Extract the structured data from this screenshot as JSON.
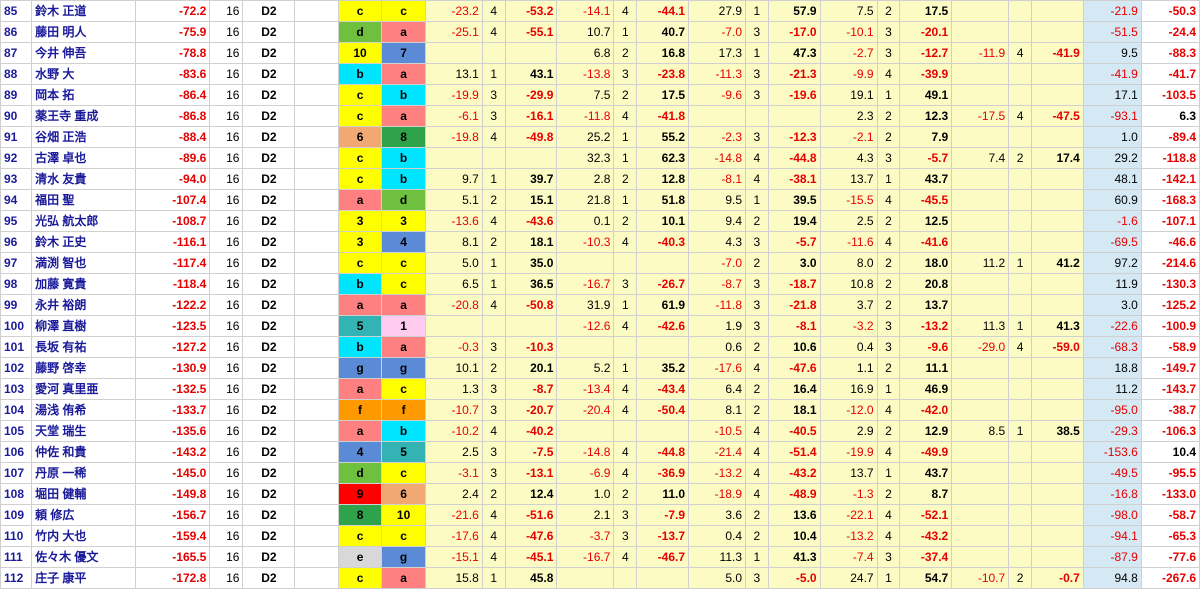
{
  "colors": {
    "a": "#ff8080",
    "b": "#00e5ff",
    "c": "#ffff00",
    "d": "#70c040",
    "e": "#d8d8d8",
    "f": "#ff9900",
    "g": "#5b8ad6",
    "1": "#ffccf0",
    "3": "#ffff00",
    "4": "#5b8ad6",
    "5": "#33b3b3",
    "6": "#f2a873",
    "7": "#5b8ad6",
    "8": "#2ea34c",
    "9": "#ff0000",
    "10": "#ffff00"
  },
  "rows": [
    {
      "no": "85",
      "name": "鈴木 正道",
      "total": "-72.2",
      "games": "16",
      "div": "D2",
      "g1": "c",
      "g2": "c",
      "cols": [
        "-23.2",
        "4",
        "-53.2",
        "-14.1",
        "4",
        "-44.1",
        "27.9",
        "1",
        "57.9",
        "7.5",
        "2",
        "17.5",
        "",
        "",
        "",
        "-21.9",
        "-50.3"
      ]
    },
    {
      "no": "86",
      "name": "藤田 明人",
      "total": "-75.9",
      "games": "16",
      "div": "D2",
      "g1": "d",
      "g2": "a",
      "cols": [
        "-25.1",
        "4",
        "-55.1",
        "10.7",
        "1",
        "40.7",
        "-7.0",
        "3",
        "-17.0",
        "-10.1",
        "3",
        "-20.1",
        "",
        "",
        "",
        "-51.5",
        "-24.4"
      ]
    },
    {
      "no": "87",
      "name": "今井 伸吾",
      "total": "-78.8",
      "games": "16",
      "div": "D2",
      "g1": "10",
      "g2": "7",
      "cols": [
        "",
        "",
        "",
        "6.8",
        "2",
        "16.8",
        "17.3",
        "1",
        "47.3",
        "-2.7",
        "3",
        "-12.7",
        "-11.9",
        "4",
        "-41.9",
        "9.5",
        "-88.3"
      ]
    },
    {
      "no": "88",
      "name": "水野 大",
      "total": "-83.6",
      "games": "16",
      "div": "D2",
      "g1": "b",
      "g2": "a",
      "cols": [
        "13.1",
        "1",
        "43.1",
        "-13.8",
        "3",
        "-23.8",
        "-11.3",
        "3",
        "-21.3",
        "-9.9",
        "4",
        "-39.9",
        "",
        "",
        "",
        "-41.9",
        "-41.7"
      ]
    },
    {
      "no": "89",
      "name": "岡本 拓",
      "total": "-86.4",
      "games": "16",
      "div": "D2",
      "g1": "c",
      "g2": "b",
      "cols": [
        "-19.9",
        "3",
        "-29.9",
        "7.5",
        "2",
        "17.5",
        "-9.6",
        "3",
        "-19.6",
        "19.1",
        "1",
        "49.1",
        "",
        "",
        "",
        "17.1",
        "-103.5"
      ]
    },
    {
      "no": "90",
      "name": "薬王寺 重成",
      "total": "-86.8",
      "games": "16",
      "div": "D2",
      "g1": "c",
      "g2": "a",
      "cols": [
        "-6.1",
        "3",
        "-16.1",
        "-11.8",
        "4",
        "-41.8",
        "",
        "",
        "",
        "2.3",
        "2",
        "12.3",
        "-17.5",
        "4",
        "-47.5",
        "-93.1",
        "6.3"
      ]
    },
    {
      "no": "91",
      "name": "谷畑 正浩",
      "total": "-88.4",
      "games": "16",
      "div": "D2",
      "g1": "6",
      "g2": "8",
      "cols": [
        "-19.8",
        "4",
        "-49.8",
        "25.2",
        "1",
        "55.2",
        "-2.3",
        "3",
        "-12.3",
        "-2.1",
        "2",
        "7.9",
        "",
        "",
        "",
        "1.0",
        "-89.4"
      ]
    },
    {
      "no": "92",
      "name": "古澤 卓也",
      "total": "-89.6",
      "games": "16",
      "div": "D2",
      "g1": "c",
      "g2": "b",
      "cols": [
        "",
        "",
        "",
        "32.3",
        "1",
        "62.3",
        "-14.8",
        "4",
        "-44.8",
        "4.3",
        "3",
        "-5.7",
        "7.4",
        "2",
        "17.4",
        "29.2",
        "-118.8"
      ]
    },
    {
      "no": "93",
      "name": "清水 友貴",
      "total": "-94.0",
      "games": "16",
      "div": "D2",
      "g1": "c",
      "g2": "b",
      "cols": [
        "9.7",
        "1",
        "39.7",
        "2.8",
        "2",
        "12.8",
        "-8.1",
        "4",
        "-38.1",
        "13.7",
        "1",
        "43.7",
        "",
        "",
        "",
        "48.1",
        "-142.1"
      ]
    },
    {
      "no": "94",
      "name": "福田 聖",
      "total": "-107.4",
      "games": "16",
      "div": "D2",
      "g1": "a",
      "g2": "d",
      "cols": [
        "5.1",
        "2",
        "15.1",
        "21.8",
        "1",
        "51.8",
        "9.5",
        "1",
        "39.5",
        "-15.5",
        "4",
        "-45.5",
        "",
        "",
        "",
        "60.9",
        "-168.3"
      ]
    },
    {
      "no": "95",
      "name": "光弘 航太郎",
      "total": "-108.7",
      "games": "16",
      "div": "D2",
      "g1": "3",
      "g2": "3",
      "cols": [
        "-13.6",
        "4",
        "-43.6",
        "0.1",
        "2",
        "10.1",
        "9.4",
        "2",
        "19.4",
        "2.5",
        "2",
        "12.5",
        "",
        "",
        "",
        "-1.6",
        "-107.1"
      ]
    },
    {
      "no": "96",
      "name": "鈴木 正史",
      "total": "-116.1",
      "games": "16",
      "div": "D2",
      "g1": "3",
      "g2": "4",
      "cols": [
        "8.1",
        "2",
        "18.1",
        "-10.3",
        "4",
        "-40.3",
        "4.3",
        "3",
        "-5.7",
        "-11.6",
        "4",
        "-41.6",
        "",
        "",
        "",
        "-69.5",
        "-46.6"
      ]
    },
    {
      "no": "97",
      "name": "満渕 智也",
      "total": "-117.4",
      "games": "16",
      "div": "D2",
      "g1": "c",
      "g2": "c",
      "cols": [
        "5.0",
        "1",
        "35.0",
        "",
        "",
        "",
        "-7.0",
        "2",
        "3.0",
        "8.0",
        "2",
        "18.0",
        "11.2",
        "1",
        "41.2",
        "97.2",
        "-214.6"
      ]
    },
    {
      "no": "98",
      "name": "加藤 寛貴",
      "total": "-118.4",
      "games": "16",
      "div": "D2",
      "g1": "b",
      "g2": "c",
      "cols": [
        "6.5",
        "1",
        "36.5",
        "-16.7",
        "3",
        "-26.7",
        "-8.7",
        "3",
        "-18.7",
        "10.8",
        "2",
        "20.8",
        "",
        "",
        "",
        "11.9",
        "-130.3"
      ]
    },
    {
      "no": "99",
      "name": "永井 裕朗",
      "total": "-122.2",
      "games": "16",
      "div": "D2",
      "g1": "a",
      "g2": "a",
      "cols": [
        "-20.8",
        "4",
        "-50.8",
        "31.9",
        "1",
        "61.9",
        "-11.8",
        "3",
        "-21.8",
        "3.7",
        "2",
        "13.7",
        "",
        "",
        "",
        "3.0",
        "-125.2"
      ]
    },
    {
      "no": "100",
      "name": "柳澤 直樹",
      "total": "-123.5",
      "games": "16",
      "div": "D2",
      "g1": "5",
      "g2": "1",
      "cols": [
        "",
        "",
        "",
        "-12.6",
        "4",
        "-42.6",
        "1.9",
        "3",
        "-8.1",
        "-3.2",
        "3",
        "-13.2",
        "11.3",
        "1",
        "41.3",
        "-22.6",
        "-100.9"
      ]
    },
    {
      "no": "101",
      "name": "長坂 有祐",
      "total": "-127.2",
      "games": "16",
      "div": "D2",
      "g1": "b",
      "g2": "a",
      "cols": [
        "-0.3",
        "3",
        "-10.3",
        "",
        "",
        "",
        "0.6",
        "2",
        "10.6",
        "0.4",
        "3",
        "-9.6",
        "-29.0",
        "4",
        "-59.0",
        "-68.3",
        "-58.9"
      ]
    },
    {
      "no": "102",
      "name": "藤野 啓幸",
      "total": "-130.9",
      "games": "16",
      "div": "D2",
      "g1": "g",
      "g2": "g",
      "cols": [
        "10.1",
        "2",
        "20.1",
        "5.2",
        "1",
        "35.2",
        "-17.6",
        "4",
        "-47.6",
        "1.1",
        "2",
        "11.1",
        "",
        "",
        "",
        "18.8",
        "-149.7"
      ]
    },
    {
      "no": "103",
      "name": "愛河 真里亜",
      "total": "-132.5",
      "games": "16",
      "div": "D2",
      "g1": "a",
      "g2": "c",
      "cols": [
        "1.3",
        "3",
        "-8.7",
        "-13.4",
        "4",
        "-43.4",
        "6.4",
        "2",
        "16.4",
        "16.9",
        "1",
        "46.9",
        "",
        "",
        "",
        "11.2",
        "-143.7"
      ]
    },
    {
      "no": "104",
      "name": "湯浅 侑希",
      "total": "-133.7",
      "games": "16",
      "div": "D2",
      "g1": "f",
      "g2": "f",
      "cols": [
        "-10.7",
        "3",
        "-20.7",
        "-20.4",
        "4",
        "-50.4",
        "8.1",
        "2",
        "18.1",
        "-12.0",
        "4",
        "-42.0",
        "",
        "",
        "",
        "-95.0",
        "-38.7"
      ]
    },
    {
      "no": "105",
      "name": "天堂 瑞生",
      "total": "-135.6",
      "games": "16",
      "div": "D2",
      "g1": "a",
      "g2": "b",
      "cols": [
        "-10.2",
        "4",
        "-40.2",
        "",
        "",
        "",
        "-10.5",
        "4",
        "-40.5",
        "2.9",
        "2",
        "12.9",
        "8.5",
        "1",
        "38.5",
        "-29.3",
        "-106.3"
      ]
    },
    {
      "no": "106",
      "name": "仲佐 和貴",
      "total": "-143.2",
      "games": "16",
      "div": "D2",
      "g1": "4",
      "g2": "5",
      "cols": [
        "2.5",
        "3",
        "-7.5",
        "-14.8",
        "4",
        "-44.8",
        "-21.4",
        "4",
        "-51.4",
        "-19.9",
        "4",
        "-49.9",
        "",
        "",
        "",
        "-153.6",
        "10.4"
      ]
    },
    {
      "no": "107",
      "name": "丹原 一稀",
      "total": "-145.0",
      "games": "16",
      "div": "D2",
      "g1": "d",
      "g2": "c",
      "cols": [
        "-3.1",
        "3",
        "-13.1",
        "-6.9",
        "4",
        "-36.9",
        "-13.2",
        "4",
        "-43.2",
        "13.7",
        "1",
        "43.7",
        "",
        "",
        "",
        "-49.5",
        "-95.5"
      ]
    },
    {
      "no": "108",
      "name": "堀田 健輔",
      "total": "-149.8",
      "games": "16",
      "div": "D2",
      "g1": "9",
      "g2": "6",
      "cols": [
        "2.4",
        "2",
        "12.4",
        "1.0",
        "2",
        "11.0",
        "-18.9",
        "4",
        "-48.9",
        "-1.3",
        "2",
        "8.7",
        "",
        "",
        "",
        "-16.8",
        "-133.0"
      ]
    },
    {
      "no": "109",
      "name": "頼 修広",
      "total": "-156.7",
      "games": "16",
      "div": "D2",
      "g1": "8",
      "g2": "10",
      "cols": [
        "-21.6",
        "4",
        "-51.6",
        "2.1",
        "3",
        "-7.9",
        "3.6",
        "2",
        "13.6",
        "-22.1",
        "4",
        "-52.1",
        "",
        "",
        "",
        "-98.0",
        "-58.7"
      ]
    },
    {
      "no": "110",
      "name": "竹内 大也",
      "total": "-159.4",
      "games": "16",
      "div": "D2",
      "g1": "c",
      "g2": "c",
      "cols": [
        "-17.6",
        "4",
        "-47.6",
        "-3.7",
        "3",
        "-13.7",
        "0.4",
        "2",
        "10.4",
        "-13.2",
        "4",
        "-43.2",
        "",
        "",
        "",
        "-94.1",
        "-65.3"
      ]
    },
    {
      "no": "111",
      "name": "佐々木 優文",
      "total": "-165.5",
      "games": "16",
      "div": "D2",
      "g1": "e",
      "g2": "g",
      "cols": [
        "-15.1",
        "4",
        "-45.1",
        "-16.7",
        "4",
        "-46.7",
        "11.3",
        "1",
        "41.3",
        "-7.4",
        "3",
        "-37.4",
        "",
        "",
        "",
        "-87.9",
        "-77.6"
      ]
    },
    {
      "no": "112",
      "name": "庄子 康平",
      "total": "-172.8",
      "games": "16",
      "div": "D2",
      "g1": "c",
      "g2": "a",
      "cols": [
        "15.8",
        "1",
        "45.8",
        "",
        "",
        "",
        "5.0",
        "3",
        "-5.0",
        "24.7",
        "1",
        "54.7",
        "-10.7",
        "2",
        "-0.7",
        "94.8",
        "-267.6"
      ]
    }
  ]
}
